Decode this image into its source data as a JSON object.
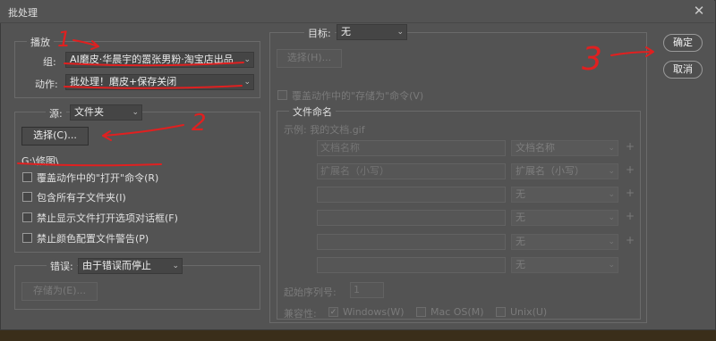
{
  "window": {
    "title": "批处理"
  },
  "play": {
    "legend": "播放",
    "set_label": "组:",
    "set_value": "AI磨皮·华晨宇的嚣张男粉·淘宝店出品",
    "action_label": "动作:",
    "action_value": "批处理！磨皮+保存关闭"
  },
  "source": {
    "label": "源:",
    "value": "文件夹",
    "choose_button": "选择(C)...",
    "path": "G:\\修图\\",
    "checkboxes": [
      "覆盖动作中的\"打开\"命令(R)",
      "包含所有子文件夹(I)",
      "禁止显示文件打开选项对话框(F)",
      "禁止颜色配置文件警告(P)"
    ]
  },
  "errors": {
    "label": "错误:",
    "value": "由于错误而停止",
    "save_as_button": "存储为(E)..."
  },
  "destination": {
    "label": "目标:",
    "value": "无",
    "choose_button": "选择(H)...",
    "override_save": "覆盖动作中的\"存储为\"命令(V)"
  },
  "naming": {
    "legend": "文件命名",
    "example": "示例: 我的文档.gif",
    "rows": [
      {
        "field": "文档名称",
        "select": "文档名称"
      },
      {
        "field": "扩展名（小写）",
        "select": "扩展名（小写）"
      },
      {
        "field": "",
        "select": "无"
      },
      {
        "field": "",
        "select": "无"
      },
      {
        "field": "",
        "select": "无"
      },
      {
        "field": "",
        "select": "无"
      }
    ],
    "plus": "+",
    "serial_label": "起始序列号:",
    "serial_value": "1",
    "compat_label": "兼容性:",
    "compat": [
      {
        "label": "Windows(W)",
        "checked": true
      },
      {
        "label": "Mac OS(M)",
        "checked": false
      },
      {
        "label": "Unix(U)",
        "checked": false
      }
    ]
  },
  "buttons": {
    "ok": "确定",
    "cancel": "取消"
  },
  "annotations": {
    "n1": "1",
    "n2": "2",
    "n3": "3"
  },
  "colors": {
    "dialog_bg": "#535353",
    "annotation": "#e02020"
  }
}
